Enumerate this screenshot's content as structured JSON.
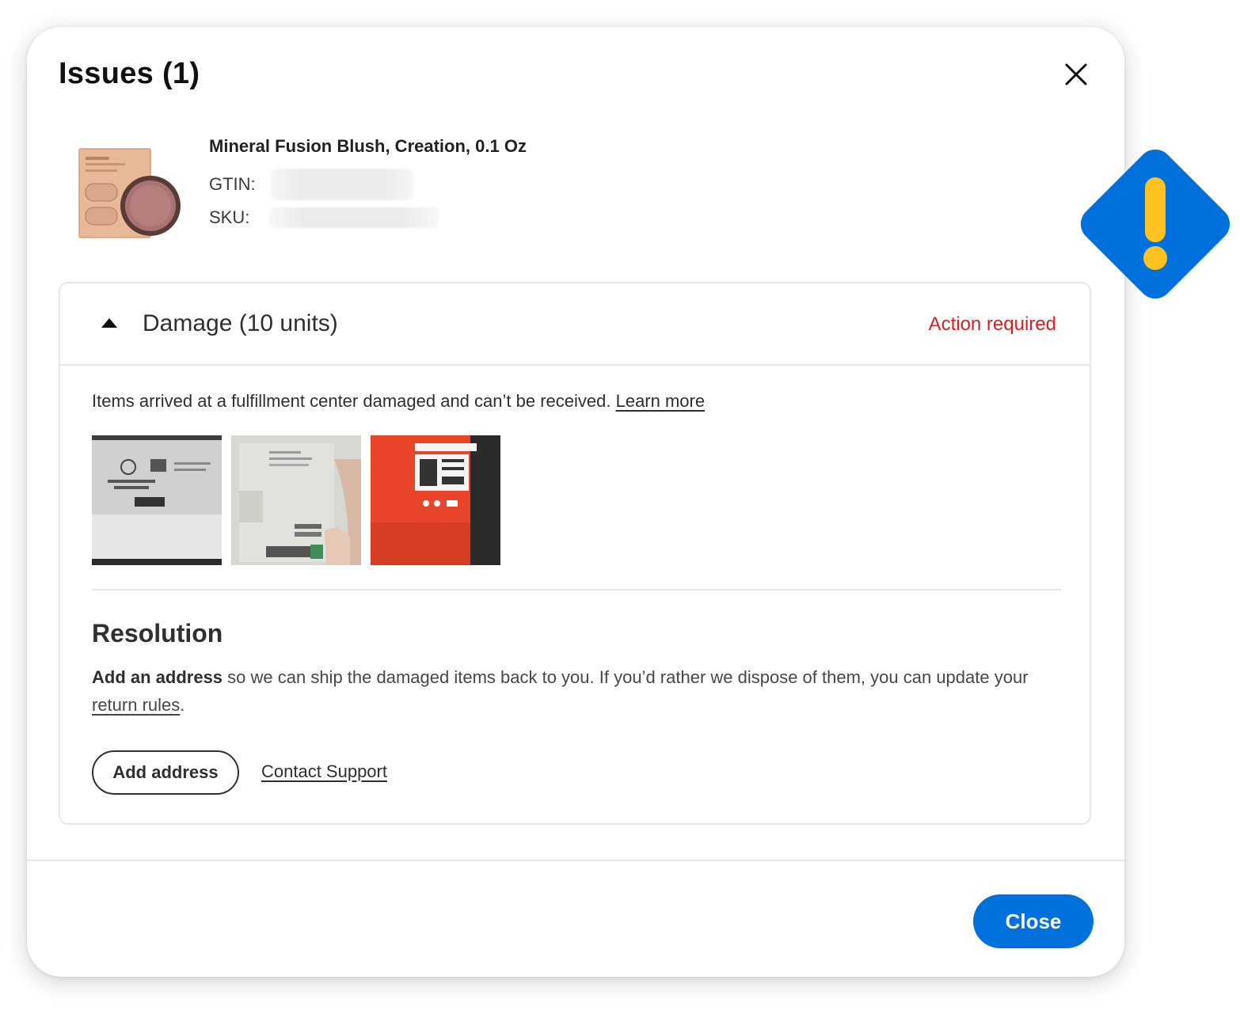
{
  "modal": {
    "title": "Issues (1)"
  },
  "product": {
    "name": "Mineral Fusion Blush, Creation, 0.1 Oz",
    "gtin_label": "GTIN:",
    "sku_label": "SKU:"
  },
  "issue": {
    "title": "Damage (10 units)",
    "status": "Action required",
    "description": "Items arrived at a fulfillment center damaged and can’t be received.",
    "learn_more": "Learn more",
    "photo_count": 3
  },
  "resolution": {
    "title": "Resolution",
    "bold_lead": "Add an address",
    "text": " so we can ship the damaged items back to you. If you’d rather we dispose of them, you can update your ",
    "link": "return rules",
    "end": ".",
    "add_address_label": "Add address",
    "contact_label": "Contact Support"
  },
  "footer": {
    "close_label": "Close"
  },
  "colors": {
    "primary_blue": "#0071dc",
    "alert_red": "#de1c24",
    "badge_yellow": "#ffc220"
  },
  "icons": {
    "close": "close-icon",
    "caret": "caret-up-icon",
    "alert": "exclamation-diamond-icon"
  }
}
